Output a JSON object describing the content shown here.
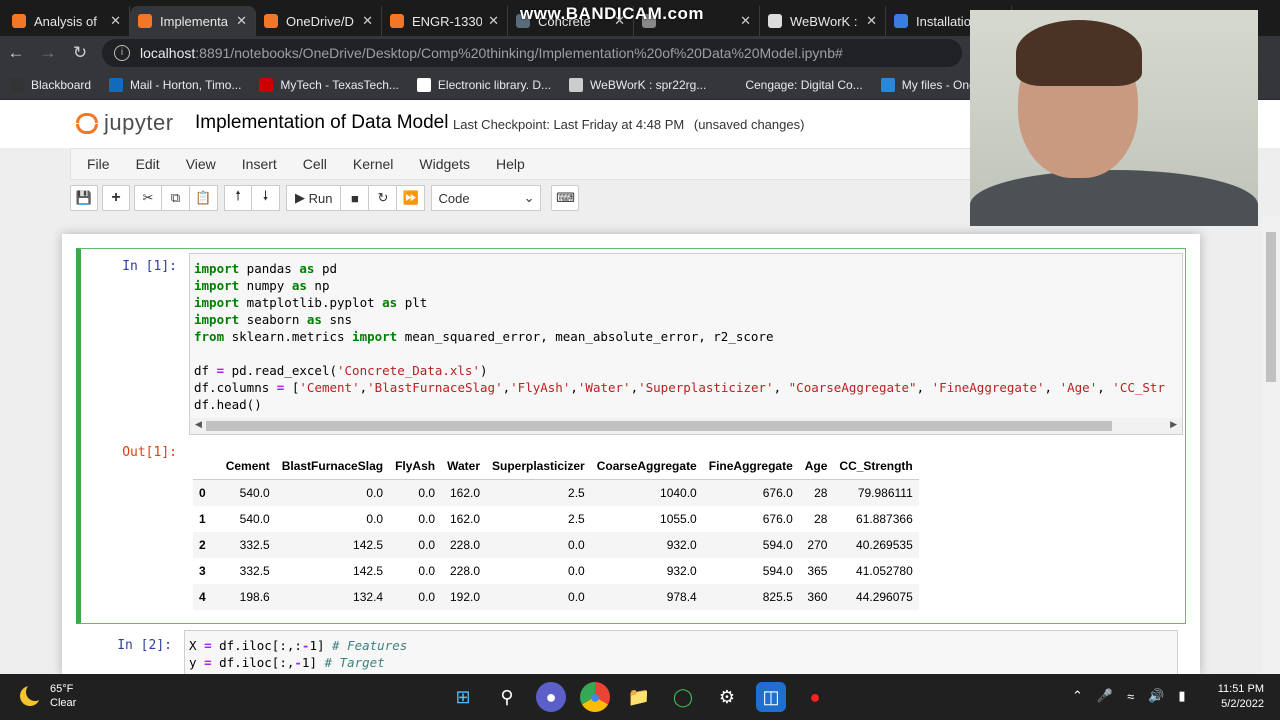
{
  "browser": {
    "tabs": [
      {
        "label": "Analysis of",
        "color": "#f37726"
      },
      {
        "label": "Implementa",
        "color": "#f37726"
      },
      {
        "label": "OneDrive/D",
        "color": "#f37726"
      },
      {
        "label": "ENGR-1330",
        "color": "#f37726"
      },
      {
        "label": "Concrete",
        "color": "#5a6b7b"
      },
      {
        "label": "",
        "color": "#888888"
      },
      {
        "label": "WeBWorK :",
        "color": "#dddddd"
      },
      {
        "label": "Installatio",
        "color": "#3d7be0"
      }
    ],
    "watermark": "www.BANDICAM.com",
    "url_host": "localhost",
    "url_path": ":8891/notebooks/OneDrive/Desktop/Comp%20thinking/Implementation%20of%20Data%20Model.ipynb#",
    "bookmarks": [
      {
        "label": "Blackboard",
        "color": "#333333"
      },
      {
        "label": "Mail - Horton, Timo...",
        "color": "#0f6cbd"
      },
      {
        "label": "MyTech - TexasTech...",
        "color": "#cc0000"
      },
      {
        "label": "Electronic library. D...",
        "color": "#ffffff"
      },
      {
        "label": "WeBWorK : spr22rg...",
        "color": "#cccccc"
      },
      {
        "label": "Cengage: Digital Co...",
        "color": "#35363a"
      },
      {
        "label": "My files - One",
        "color": "#2b88d8"
      }
    ]
  },
  "jupyter": {
    "logo_text": "jupyter",
    "title": "Implementation of Data Model",
    "checkpoint": "Last Checkpoint: Last Friday at 4:48 PM",
    "unsaved": "(unsaved changes)",
    "menu": [
      "File",
      "Edit",
      "View",
      "Insert",
      "Cell",
      "Kernel",
      "Widgets",
      "Help"
    ],
    "run_label": "Run",
    "cell_type": "Code"
  },
  "cell1": {
    "in_prompt": "In [1]:",
    "out_prompt": "Out[1]:",
    "columns": [
      "",
      "Cement",
      "BlastFurnaceSlag",
      "FlyAsh",
      "Water",
      "Superplasticizer",
      "CoarseAggregate",
      "FineAggregate",
      "Age",
      "CC_Strength"
    ],
    "rows": [
      [
        "0",
        "540.0",
        "0.0",
        "0.0",
        "162.0",
        "2.5",
        "1040.0",
        "676.0",
        "28",
        "79.986111"
      ],
      [
        "1",
        "540.0",
        "0.0",
        "0.0",
        "162.0",
        "2.5",
        "1055.0",
        "676.0",
        "28",
        "61.887366"
      ],
      [
        "2",
        "332.5",
        "142.5",
        "0.0",
        "228.0",
        "0.0",
        "932.0",
        "594.0",
        "270",
        "40.269535"
      ],
      [
        "3",
        "332.5",
        "142.5",
        "0.0",
        "228.0",
        "0.0",
        "932.0",
        "594.0",
        "365",
        "41.052780"
      ],
      [
        "4",
        "198.6",
        "132.4",
        "0.0",
        "192.0",
        "0.0",
        "978.4",
        "825.5",
        "360",
        "44.296075"
      ]
    ]
  },
  "cell2": {
    "in_prompt": "In [2]:"
  },
  "taskbar": {
    "temp": "65°F",
    "condition": "Clear",
    "time": "11:51 PM",
    "date": "5/2/2022"
  }
}
